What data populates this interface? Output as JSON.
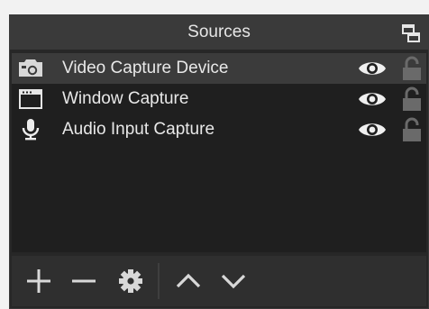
{
  "dock": {
    "title": "Sources",
    "title_color": "#e6e6e6",
    "background": "#272727",
    "title_bar_color": "#3a3a3a",
    "selected_row_color": "#3b3b3b"
  },
  "sources": [
    {
      "label": "Video Capture Device",
      "icon": "camera-icon",
      "visible": true,
      "locked": false,
      "selected": true
    },
    {
      "label": "Window Capture",
      "icon": "window-icon",
      "visible": true,
      "locked": false,
      "selected": false
    },
    {
      "label": "Audio Input Capture",
      "icon": "microphone-icon",
      "visible": true,
      "locked": false,
      "selected": false
    }
  ],
  "toolbar": {
    "buttons": [
      {
        "name": "add-source-button",
        "icon": "plus-icon"
      },
      {
        "name": "remove-source-button",
        "icon": "minus-icon"
      },
      {
        "name": "source-properties-button",
        "icon": "gear-icon"
      },
      {
        "name": "move-source-up-button",
        "icon": "chevron-up-icon"
      },
      {
        "name": "move-source-down-button",
        "icon": "chevron-down-icon"
      }
    ]
  }
}
